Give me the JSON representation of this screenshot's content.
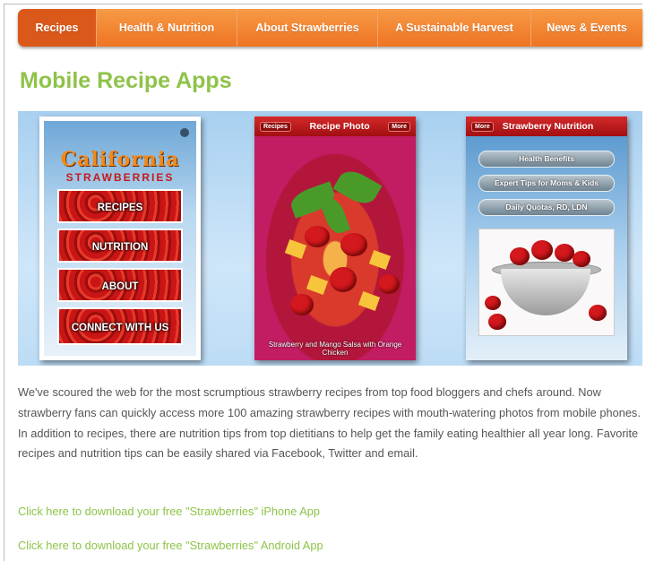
{
  "nav": {
    "items": [
      "Recipes",
      "Health & Nutrition",
      "About Strawberries",
      "A Sustainable Harvest",
      "News & Events"
    ]
  },
  "page": {
    "title": "Mobile Recipe Apps"
  },
  "banner": {
    "phone1": {
      "logo_top": "California",
      "logo_bottom": "STRAWBERRIES",
      "buttons": [
        "RECIPES",
        "NUTRITION",
        "ABOUT",
        "CONNECT WITH US"
      ]
    },
    "phone2": {
      "back_label": "Recipes",
      "title": "Recipe Photo",
      "more_label": "More",
      "caption": "Strawberry and Mango Salsa with Orange Chicken"
    },
    "phone3": {
      "back_label": "More",
      "title": "Strawberry Nutrition",
      "buttons": [
        "Health Benefits",
        "Expert Tips for Moms & Kids",
        "Daily Quotas, RD, LDN"
      ]
    }
  },
  "description": "We've scoured the web for the most scrumptious strawberry recipes from top food bloggers and chefs around. Now strawberry fans can quickly access more 100 amazing strawberry recipes with mouth-watering photos from mobile phones. In addition to recipes, there are nutrition tips from top dietitians to help get the family eating healthier all year long. Favorite recipes and nutrition tips can be easily shared via Facebook, Twitter and email.",
  "links": {
    "iphone": "Click here to download your free \"Strawberries\" iPhone App",
    "android": "Click here to download your free \"Strawberries\" Android App"
  },
  "colors": {
    "nav_orange": "#ee7422",
    "title_green": "#8ec349",
    "link_green": "#8ec349",
    "strawberry_red": "#c61a1a"
  }
}
